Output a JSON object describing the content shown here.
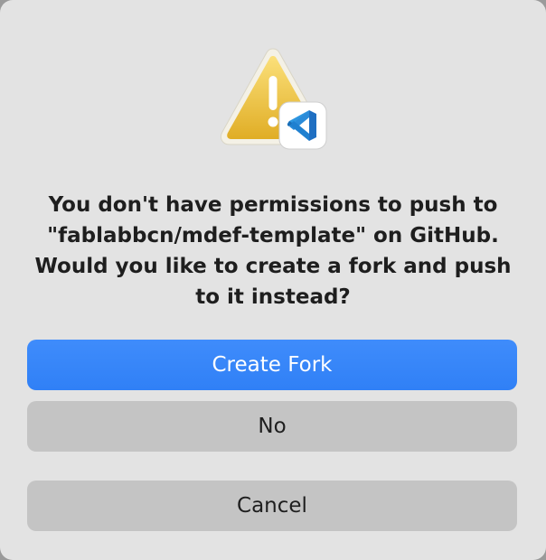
{
  "dialog": {
    "icon": "warning-triangle-with-vscode-badge",
    "message": "You don't have permissions to push to\n\"fablabbcn/mdef-template\" on GitHub.\nWould you like to create a fork and push\nto it instead?",
    "colors": {
      "background": "#e3e3e3",
      "primary_button": "#3584f8",
      "secondary_button": "#c4c4c4",
      "warning": "#f0c23a",
      "vscode_blue": "#1f8ad2"
    }
  },
  "buttons": {
    "create_fork_label": "Create Fork",
    "no_label": "No",
    "cancel_label": "Cancel"
  }
}
